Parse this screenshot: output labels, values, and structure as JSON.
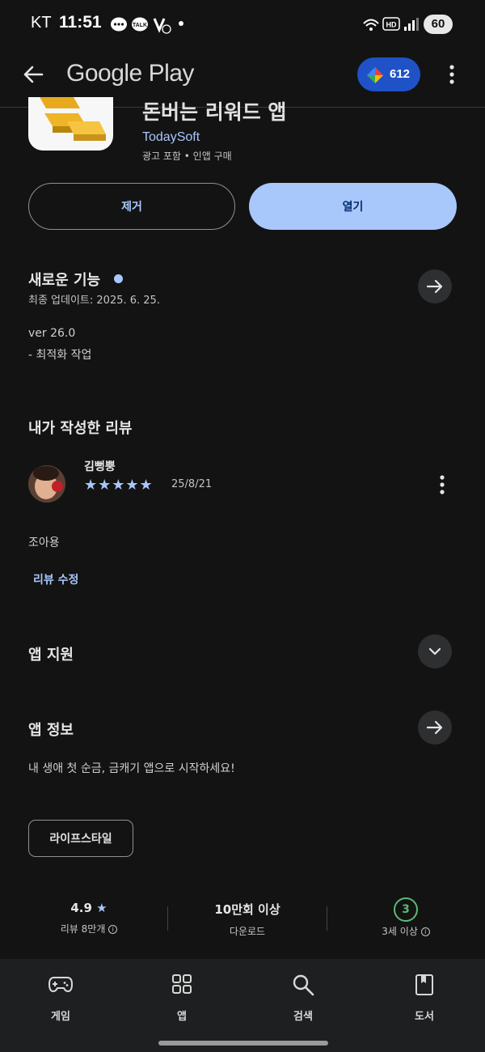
{
  "status_bar": {
    "carrier": "KT",
    "time": "11:51",
    "battery": "60"
  },
  "app_bar": {
    "title": "Google Play",
    "points": "612"
  },
  "app": {
    "title": "돈버는 리워드 앱",
    "developer": "TodaySoft",
    "meta": "광고 포함 • 인앱 구매",
    "remove_label": "제거",
    "open_label": "열기"
  },
  "whats_new": {
    "title": "새로운 기능",
    "updated": "최종 업데이트: 2025. 6. 25.",
    "version": "ver 26.0",
    "notes": "- 최적화 작업"
  },
  "my_review": {
    "title": "내가 작성한 리뷰",
    "reviewer": "김뻥뿡",
    "rating": 5,
    "stars": "★★★★★",
    "date": "25/8/21",
    "text": "조아용",
    "edit_label": "리뷰 수정"
  },
  "app_support": {
    "title": "앱 지원"
  },
  "about": {
    "title": "앱 정보",
    "description": "내 생애 첫 순금, 금캐기 앱으로 시작하세요!",
    "category": "라이프스타일"
  },
  "stats": {
    "rating": "4.9",
    "reviews": "리뷰 8만개",
    "downloads": "10만회 이상",
    "downloads_label": "다운로드",
    "age_rating": "3",
    "age_label": "3세 이상"
  },
  "bottom_nav": {
    "games": "게임",
    "apps": "앱",
    "search": "검색",
    "books": "도서"
  },
  "colors": {
    "background": "#131313",
    "accent": "#a8c7fa",
    "points_badge": "#1f52c7",
    "age_badge": "#5bb974"
  }
}
